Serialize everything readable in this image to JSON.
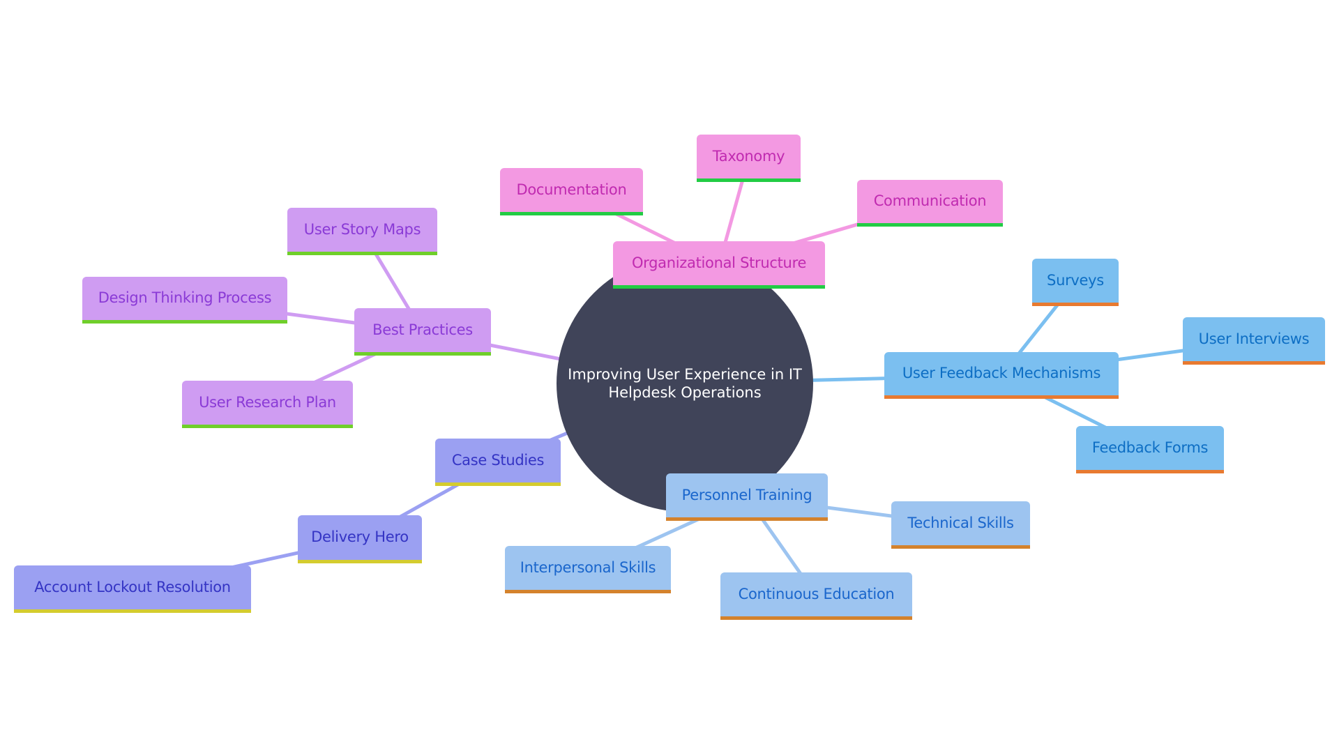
{
  "diagram": {
    "type": "mindmap",
    "root": {
      "id": "root",
      "label": "Improving User Experience in IT Helpdesk Operations",
      "color": "#404459",
      "text_color": "#ffffff"
    },
    "palette": {
      "pink": {
        "fill": "#f399e2",
        "text": "#c02ab0",
        "accent": "#22cc44",
        "edge": "#f399e2"
      },
      "purple": {
        "fill": "#cf9cf2",
        "text": "#8a3ad6",
        "accent": "#6fcf2a",
        "edge": "#cf9cf2"
      },
      "indigo": {
        "fill": "#9ba0f2",
        "text": "#3434c4",
        "accent": "#d4cc2e",
        "edge": "#9ba0f2"
      },
      "sky": {
        "fill": "#7bbff0",
        "text": "#0d6ec4",
        "accent": "#e87a30",
        "edge": "#7bbff0"
      },
      "lblue": {
        "fill": "#9dc4f0",
        "text": "#1a66cc",
        "accent": "#d4822c",
        "edge": "#9dc4f0"
      }
    },
    "nodes": [
      {
        "id": "org",
        "label": "Organizational Structure",
        "parent": "root",
        "theme": "pink"
      },
      {
        "id": "doc",
        "label": "Documentation",
        "parent": "org",
        "theme": "pink"
      },
      {
        "id": "tax",
        "label": "Taxonomy",
        "parent": "org",
        "theme": "pink"
      },
      {
        "id": "comm",
        "label": "Communication",
        "parent": "org",
        "theme": "pink"
      },
      {
        "id": "best",
        "label": "Best Practices",
        "parent": "root",
        "theme": "purple"
      },
      {
        "id": "story",
        "label": "User Story Maps",
        "parent": "best",
        "theme": "purple"
      },
      {
        "id": "design",
        "label": "Design Thinking Process",
        "parent": "best",
        "theme": "purple"
      },
      {
        "id": "research",
        "label": "User Research Plan",
        "parent": "best",
        "theme": "purple"
      },
      {
        "id": "cases",
        "label": "Case Studies",
        "parent": "root",
        "theme": "indigo"
      },
      {
        "id": "delivery",
        "label": "Delivery Hero",
        "parent": "cases",
        "theme": "indigo"
      },
      {
        "id": "lockout",
        "label": "Account Lockout Resolution",
        "parent": "delivery",
        "theme": "indigo"
      },
      {
        "id": "feedback",
        "label": "User Feedback Mechanisms",
        "parent": "root",
        "theme": "sky"
      },
      {
        "id": "surveys",
        "label": "Surveys",
        "parent": "feedback",
        "theme": "sky"
      },
      {
        "id": "interviews",
        "label": "User Interviews",
        "parent": "feedback",
        "theme": "sky"
      },
      {
        "id": "forms",
        "label": "Feedback Forms",
        "parent": "feedback",
        "theme": "sky"
      },
      {
        "id": "training",
        "label": "Personnel Training",
        "parent": "root",
        "theme": "lblue"
      },
      {
        "id": "technical",
        "label": "Technical Skills",
        "parent": "training",
        "theme": "lblue"
      },
      {
        "id": "interpers",
        "label": "Interpersonal Skills",
        "parent": "training",
        "theme": "lblue"
      },
      {
        "id": "continuous",
        "label": "Continuous Education",
        "parent": "training",
        "theme": "lblue"
      }
    ]
  }
}
